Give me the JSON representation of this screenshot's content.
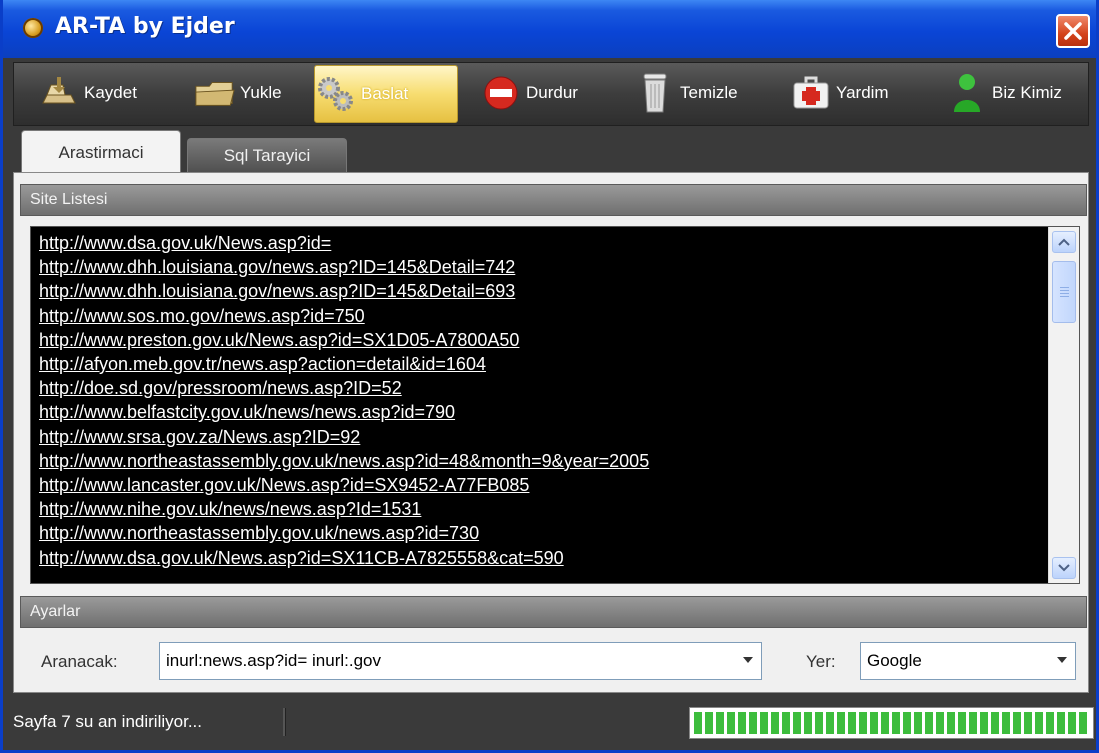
{
  "window": {
    "title": "AR-TA by Ejder"
  },
  "toolbar": {
    "buttons": [
      {
        "label": "Kaydet",
        "icon": "save-icon"
      },
      {
        "label": "Yukle",
        "icon": "load-folder-icon"
      },
      {
        "label": "Baslat",
        "icon": "gears-icon",
        "active": true
      },
      {
        "label": "Durdur",
        "icon": "stop-icon"
      },
      {
        "label": "Temizle",
        "icon": "trash-icon"
      },
      {
        "label": "Yardim",
        "icon": "first-aid-icon"
      },
      {
        "label": "Biz Kimiz",
        "icon": "user-icon"
      }
    ]
  },
  "tabs": [
    {
      "label": "Arastirmaci",
      "active": true
    },
    {
      "label": "Sql Tarayici",
      "active": false
    }
  ],
  "site_list": {
    "header": "Site Listesi",
    "urls": [
      "http://www.dsa.gov.uk/News.asp?id=",
      "http://www.dhh.louisiana.gov/news.asp?ID=145&Detail=742",
      "http://www.dhh.louisiana.gov/news.asp?ID=145&Detail=693",
      "http://www.sos.mo.gov/news.asp?id=750",
      "http://www.preston.gov.uk/News.asp?id=SX1D05-A7800A50",
      "http://afyon.meb.gov.tr/news.asp?action=detail&id=1604",
      "http://doe.sd.gov/pressroom/news.asp?ID=52",
      "http://www.belfastcity.gov.uk/news/news.asp?id=790",
      "http://www.srsa.gov.za/News.asp?ID=92",
      "http://www.northeastassembly.gov.uk/news.asp?id=48&month=9&year=2005",
      "http://www.lancaster.gov.uk/News.asp?id=SX9452-A77FB085",
      "http://www.nihe.gov.uk/news/news.asp?Id=1531",
      "http://www.northeastassembly.gov.uk/news.asp?id=730",
      "http://www.dsa.gov.uk/News.asp?id=SX11CB-A7825558&cat=590"
    ]
  },
  "settings": {
    "header": "Ayarlar",
    "search_label": "Aranacak:",
    "search_value": "inurl:news.asp?id= inurl:.gov",
    "location_label": "Yer:",
    "location_value": "Google"
  },
  "status": {
    "text": "Sayfa 7 su an indiriliyor...",
    "progress_fraction": 1.0
  },
  "colors": {
    "title_bar": "#0a45d6",
    "progress": "#3dbd3d",
    "list_background": "#000000"
  }
}
